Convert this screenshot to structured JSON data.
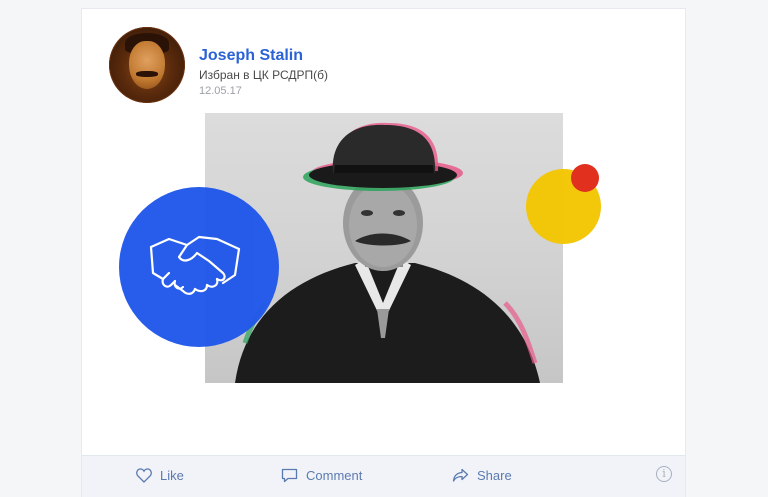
{
  "post": {
    "author_name": "Joseph Stalin",
    "subtitle": "Избран в ЦК РСДРП(б)",
    "date": "12.05.17"
  },
  "actions": {
    "like": {
      "label": "Like",
      "icon": "heart-icon"
    },
    "comment": {
      "label": "Comment",
      "icon": "comment-icon"
    },
    "share": {
      "label": "Share",
      "icon": "share-icon"
    },
    "info": {
      "glyph": "i",
      "icon": "info-icon"
    }
  },
  "colors": {
    "accent_blue": "#2158ea",
    "name_blue": "#2b62d6",
    "yellow": "#f2c500",
    "red": "#e1301e",
    "action_text": "#5b7ab0"
  },
  "decorations": {
    "blue_circle_icon": "handshake-icon"
  }
}
